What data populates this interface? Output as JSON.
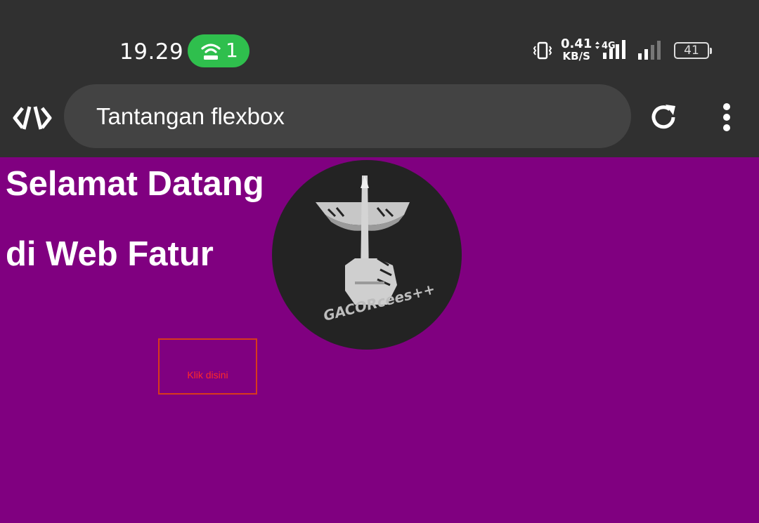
{
  "status_bar": {
    "time": "19.29",
    "hotspot_count": "1",
    "net_speed_value": "0.41",
    "net_speed_unit": "KB/S",
    "network_type": "4G",
    "battery_level": "41"
  },
  "browser": {
    "page_title": "Tantangan flexbox"
  },
  "page": {
    "heading_line1": "Selamat Datang",
    "heading_line2": "di Web Fatur",
    "logo_text": "GACORcees++",
    "button_label": "Klik disini"
  },
  "colors": {
    "page_background": "#800080",
    "chrome_background": "#303030",
    "hotspot_badge": "#2fbf4d",
    "button_border": "#d83a1c",
    "button_text": "#ff2a2a"
  },
  "icons": {
    "hotspot": "wifi-hotspot-icon",
    "vibrate": "vibrate-icon",
    "signal": "signal-icon",
    "battery": "battery-icon",
    "developer": "code-icon",
    "reload": "reload-icon",
    "menu": "more-vert-icon"
  }
}
